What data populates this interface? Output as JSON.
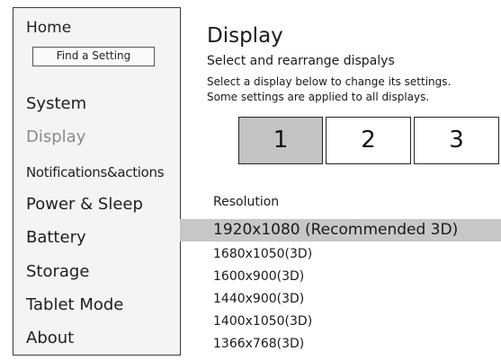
{
  "sidebar": {
    "home": "Home",
    "find_setting": "Find a Setting",
    "items": [
      {
        "label": "System"
      },
      {
        "label": "Display"
      },
      {
        "label": "Notifications&actions"
      },
      {
        "label": "Power & Sleep"
      },
      {
        "label": "Battery"
      },
      {
        "label": "Storage"
      },
      {
        "label": "Tablet Mode"
      },
      {
        "label": "About"
      }
    ],
    "active_index": 1
  },
  "main": {
    "title": "Display",
    "subtitle": "Select and rearrange dispalys",
    "desc_line1": "Select a display below to change its settings.",
    "desc_line2": "Some settings are applied to all displays.",
    "monitors": [
      {
        "label": "1",
        "selected": true
      },
      {
        "label": "2",
        "selected": false
      },
      {
        "label": "3",
        "selected": false
      }
    ],
    "resolution": {
      "label": "Resolution",
      "options": [
        "1920x1080 (Recommended 3D)",
        "1680x1050(3D)",
        "1600x900(3D)",
        "1440x900(3D)",
        "1400x1050(3D)",
        "1366x768(3D)"
      ],
      "selected_index": 0
    }
  }
}
